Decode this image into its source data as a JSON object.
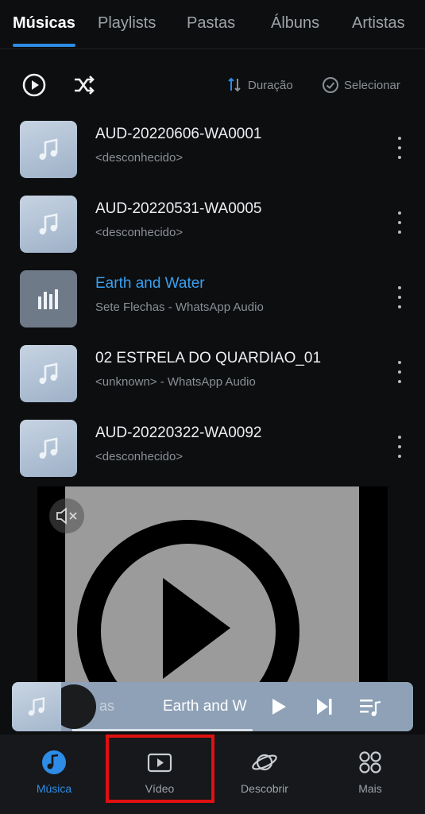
{
  "tabs": [
    {
      "label": "Músicas",
      "active": true
    },
    {
      "label": "Playlists",
      "active": false
    },
    {
      "label": "Pastas",
      "active": false
    },
    {
      "label": "Álbuns",
      "active": false
    },
    {
      "label": "Artistas",
      "active": false
    }
  ],
  "toolbar": {
    "play_icon": "play-circle-icon",
    "shuffle_icon": "shuffle-icon",
    "sort_label": "Duração",
    "select_label": "Selecionar"
  },
  "tracks": [
    {
      "title": "AUD-20220606-WA0001",
      "subtitle": "<desconhecido>",
      "playing": false
    },
    {
      "title": "AUD-20220531-WA0005",
      "subtitle": "<desconhecido>",
      "playing": false
    },
    {
      "title": "Earth and Water",
      "subtitle": "Sete Flechas - WhatsApp Audio",
      "playing": true
    },
    {
      "title": "02 ESTRELA DO QUARDIAO_01",
      "subtitle": "<unknown> - WhatsApp Audio",
      "playing": false
    },
    {
      "title": "AUD-20220322-WA0092",
      "subtitle": "<desconhecido>",
      "playing": false
    }
  ],
  "mini_player": {
    "prev_fragment": "as",
    "title": "Earth and W",
    "progress": 0.45
  },
  "bottom_nav": [
    {
      "label": "Música",
      "icon": "music-note-icon",
      "active": true
    },
    {
      "label": "Vídeo",
      "icon": "video-play-icon",
      "active": false
    },
    {
      "label": "Descobrir",
      "icon": "planet-icon",
      "active": false
    },
    {
      "label": "Mais",
      "icon": "grid-icon",
      "active": false
    }
  ],
  "colors": {
    "accent": "#2d8ce6",
    "highlight_box": "#e01010"
  }
}
